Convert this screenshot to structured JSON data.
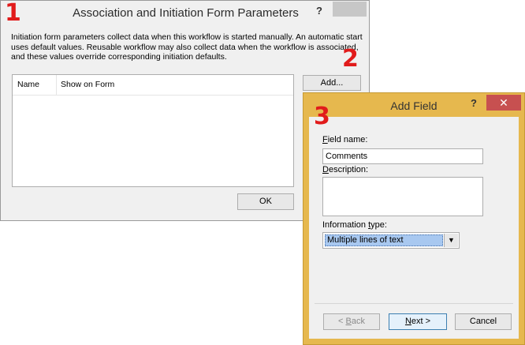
{
  "dialog_params": {
    "title": "Association and Initiation Form Parameters",
    "help_glyph": "?",
    "close_glyph": "✕",
    "description": "Initiation form parameters collect data when this workflow is started manually. An automatic start uses default values. Reusable workflow may also collect data when the workflow is associated, and these values override corresponding initiation defaults.",
    "columns": [
      "Name",
      "Show on Form"
    ],
    "add_label": "Add...",
    "ok_label": "OK"
  },
  "dialog_add_field": {
    "title": "Add Field",
    "help_glyph": "?",
    "close_glyph": "✕",
    "field_name_label_access": "F",
    "field_name_label_rest": "ield name:",
    "field_name_value": "Comments",
    "description_label_access": "D",
    "description_label_rest": "escription:",
    "description_value": "",
    "info_type_label_pre": "Information ",
    "info_type_label_access": "t",
    "info_type_label_rest": "ype:",
    "info_type_value": "Multiple lines of text",
    "back_prefix": "< ",
    "back_access": "B",
    "back_rest": "ack",
    "next_access": "N",
    "next_rest": "ext >",
    "cancel_label": "Cancel"
  },
  "annotations": [
    "1",
    "2",
    "3"
  ],
  "colors": {
    "annotation": "#e11b1b",
    "dialog_frame": "#e6b84e",
    "close_red": "#c75050",
    "selection": "#a8c8f0"
  }
}
